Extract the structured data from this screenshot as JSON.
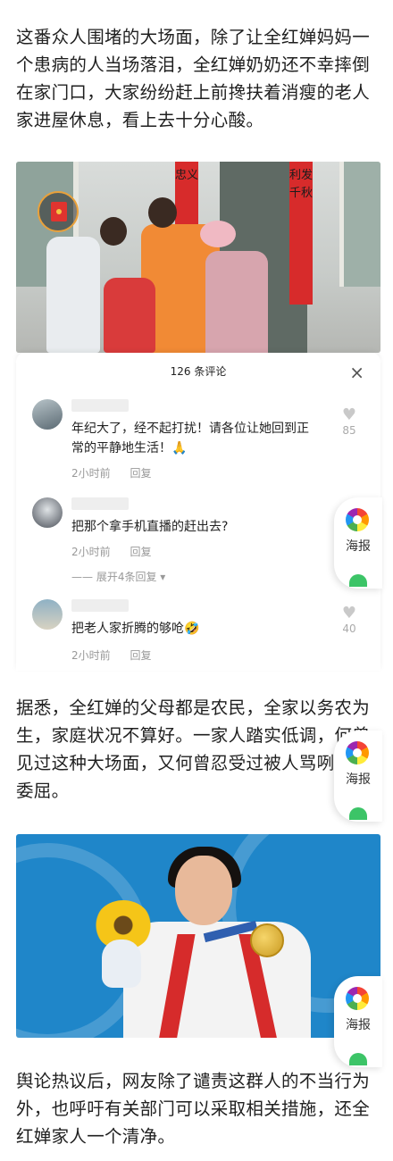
{
  "article": {
    "paragraph_1": "这番众人围堵的大场面，除了让全红婵妈妈一个患病的人当场落泪，全红婵奶奶还不幸摔倒在家门口，大家纷纷赶上前搀扶着消瘦的老人家进屋休息，看上去十分心酸。",
    "paragraph_2": "据悉，全红婵的父母都是农民，全家以务农为生，家庭状况不算好。一家人踏实低调，何曾见过这种大场面，又何曾忍受过被人骂咧咧的委屈。",
    "paragraph_3": "舆论热议后，网友除了谴责这群人的不当行为外，也呼吁有关部门可以采取相关措施，还全红婵家人一个清净。"
  },
  "photo1": {
    "couplet_left": "忠义",
    "couplet_right": "利发千秋"
  },
  "comments_panel": {
    "title": "126 条评论",
    "close_label": "×",
    "comments": [
      {
        "username": "",
        "text_line1": "年纪大了，经不起打扰！请各位让她回到正",
        "text_line2": "常的平静地生活！🙏",
        "time": "2小时前",
        "reply": "回复",
        "likes": "85"
      },
      {
        "username": "",
        "text_line1": "把那个拿手机直播的赶出去?",
        "time": "2小时前",
        "reply": "回复",
        "expand": "—— 展开4条回复 ▾"
      },
      {
        "username": "",
        "text_line1": "把老人家折腾的够呛🤣",
        "time": "2小时前",
        "reply": "回复",
        "likes": "40"
      }
    ]
  },
  "share_button": {
    "label": "海报",
    "icon": "poster-flower-icon"
  },
  "colors": {
    "background": "#ffffff",
    "text": "#1f1f1f",
    "muted": "#999999",
    "couplet_red": "#d72b2b",
    "pool_blue": "#1f86c9"
  }
}
